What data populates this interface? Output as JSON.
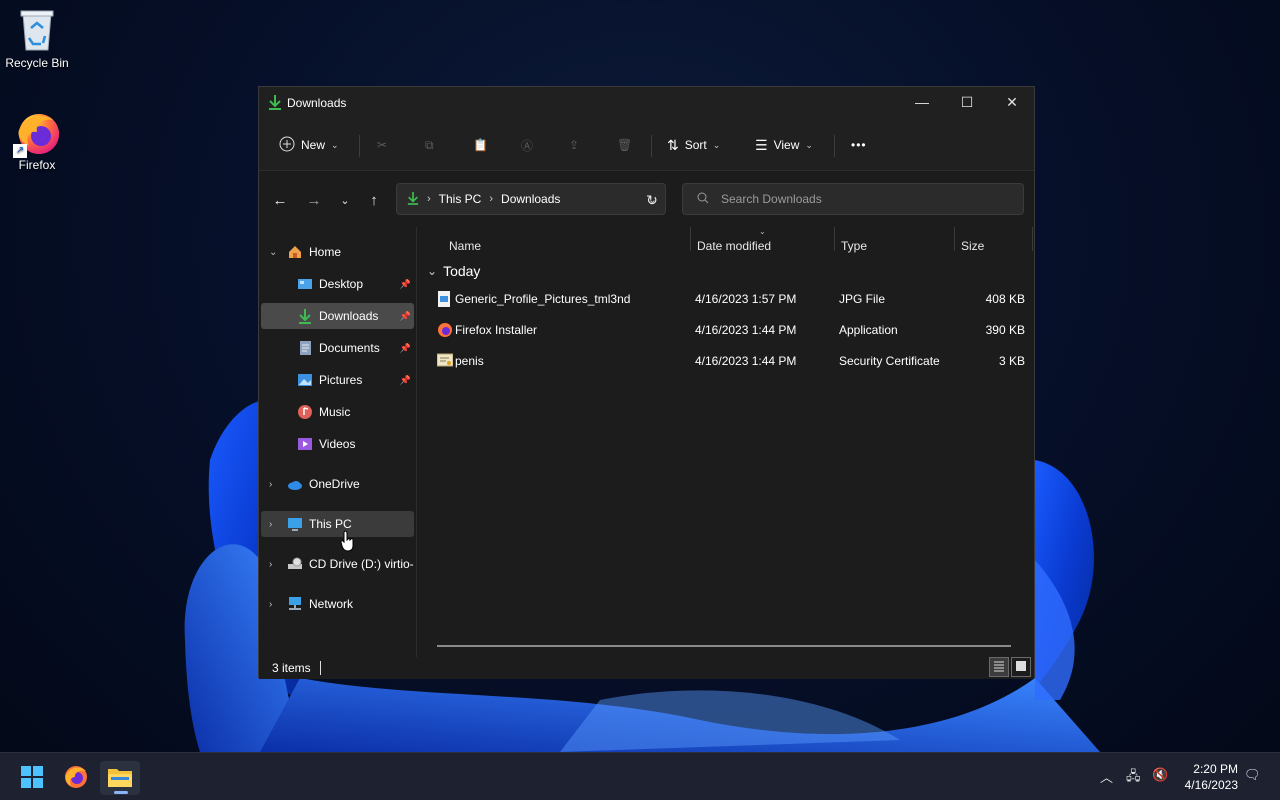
{
  "desktop": {
    "icons": [
      {
        "label": "Recycle Bin",
        "icon": "recycle-bin-icon"
      },
      {
        "label": "Firefox",
        "icon": "firefox-icon"
      }
    ]
  },
  "window": {
    "title": "Downloads",
    "controls": {
      "minimize": "—",
      "maximize": "☐",
      "close": "✕"
    },
    "commandbar": {
      "new_label": "New",
      "sort_label": "Sort",
      "view_label": "View",
      "more_label": "•••"
    },
    "address": {
      "crumbs": [
        "This PC",
        "Downloads"
      ]
    },
    "search": {
      "placeholder": "Search Downloads"
    },
    "nav": {
      "home": "Home",
      "quick_access": [
        "Desktop",
        "Downloads",
        "Documents",
        "Pictures",
        "Music",
        "Videos"
      ],
      "onedrive": "OneDrive",
      "this_pc": "This PC",
      "cd_drive": "CD Drive (D:) virtio-",
      "network": "Network"
    },
    "columns": {
      "name": "Name",
      "date": "Date modified",
      "type": "Type",
      "size": "Size"
    },
    "group_label": "Today",
    "files": [
      {
        "name": "Generic_Profile_Pictures_tml3nd",
        "date": "4/16/2023 1:57 PM",
        "type": "JPG File",
        "size": "408 KB",
        "icon": "jpg-file-icon"
      },
      {
        "name": "Firefox Installer",
        "date": "4/16/2023 1:44 PM",
        "type": "Application",
        "size": "390 KB",
        "icon": "firefox-installer-icon"
      },
      {
        "name": "penis",
        "date": "4/16/2023 1:44 PM",
        "type": "Security Certificate",
        "size": "3 KB",
        "icon": "certificate-icon"
      }
    ],
    "status": {
      "items_count": "3 items"
    }
  },
  "taskbar": {
    "time": "2:20 PM",
    "date": "4/16/2023"
  },
  "colors": {
    "accent": "#4cc2ff",
    "download_green": "#3fb950",
    "folder_yellow": "#f3c23a"
  }
}
